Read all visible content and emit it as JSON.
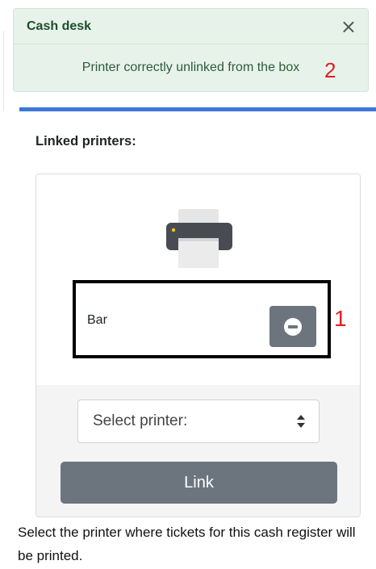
{
  "toast": {
    "title": "Cash desk",
    "message": "Printer correctly unlinked from the box",
    "close_symbol": "×"
  },
  "annotations": {
    "marker_1": "1",
    "marker_2": "2"
  },
  "section": {
    "label": "Linked printers:"
  },
  "linked_printer": {
    "name": "Bar",
    "icon": "printer-icon",
    "unlink_icon": "minus-circle-icon"
  },
  "printer_select": {
    "selected": "Select printer:",
    "icon": "sort-arrows-icon"
  },
  "link_button": {
    "label": "Link"
  },
  "help": {
    "text": "Select the printer where tickets for this cash register will be printed."
  },
  "colors": {
    "toast_bg": "#e7f3ea",
    "accent_blue": "#3b77d6",
    "button_gray": "#6c757d",
    "annotation_red": "#e02020"
  }
}
